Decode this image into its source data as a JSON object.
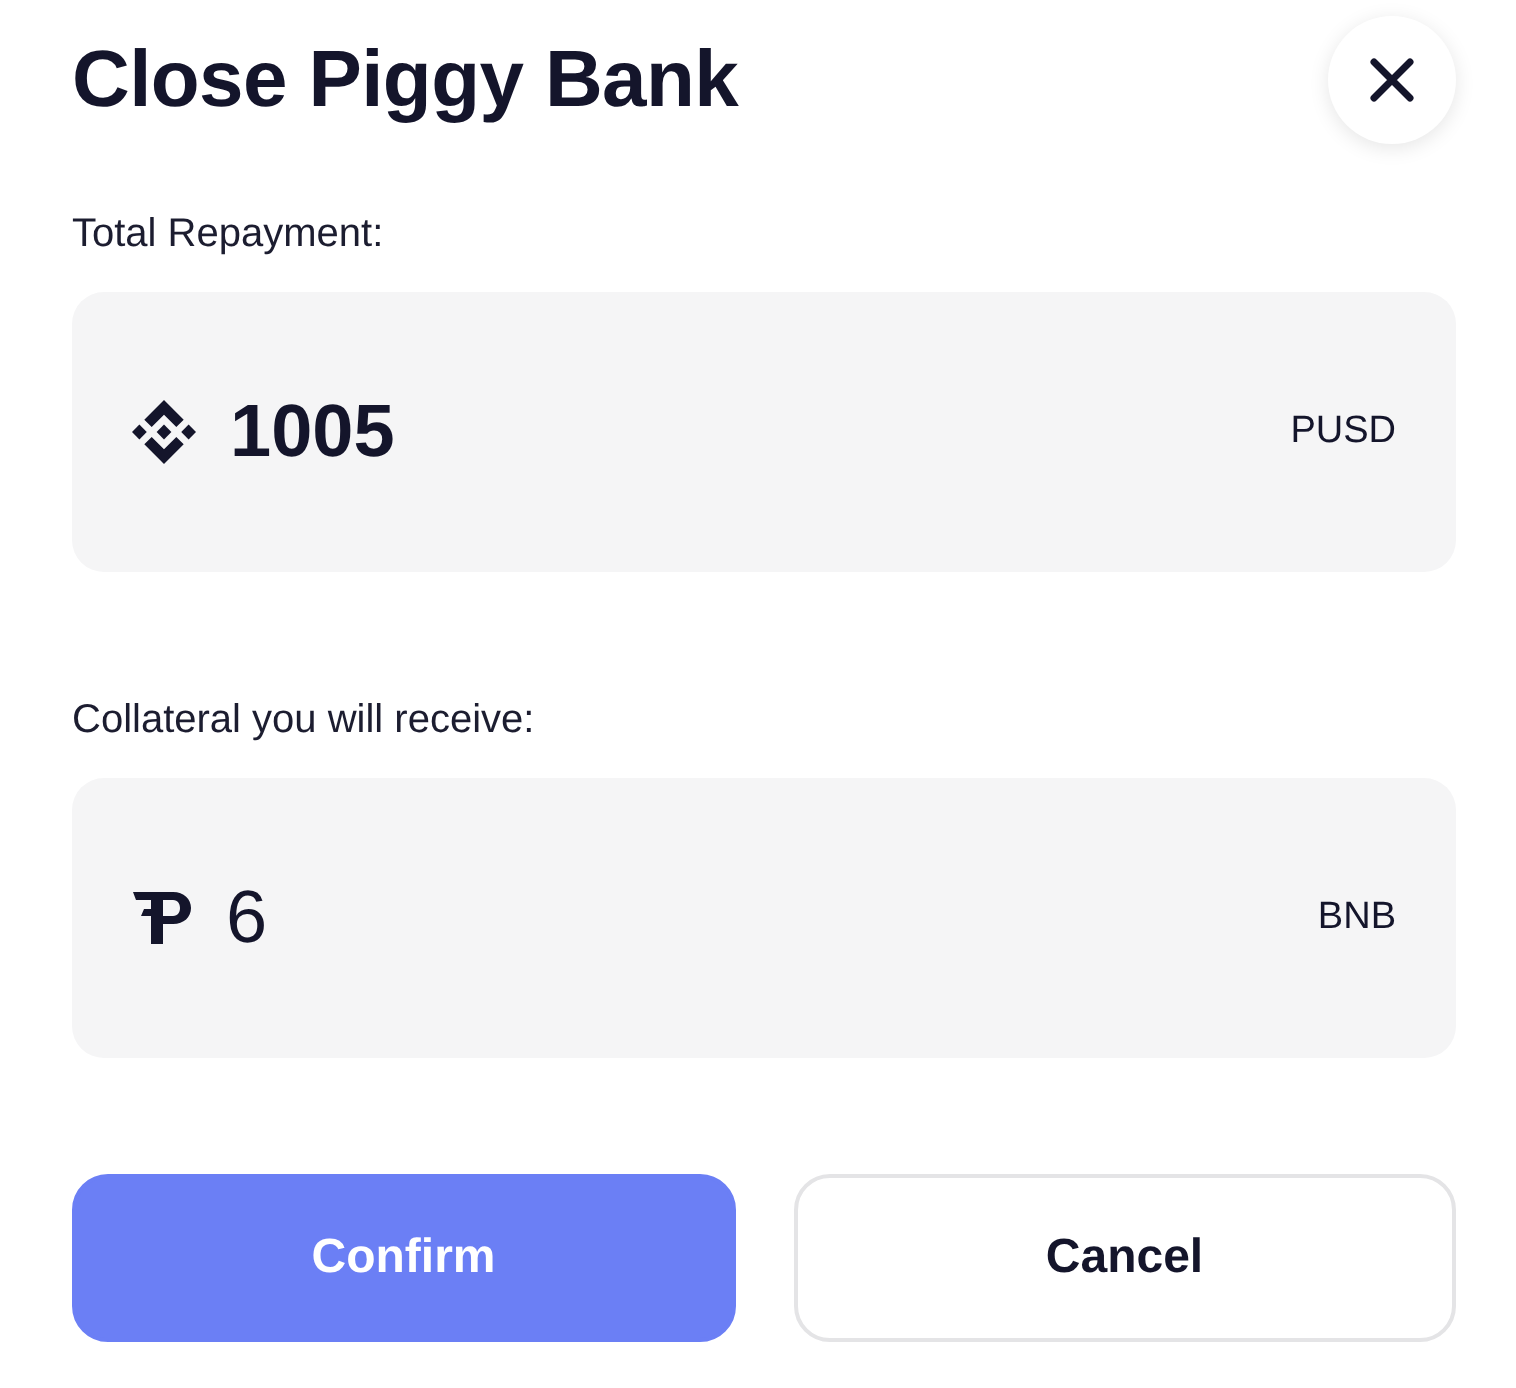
{
  "dialog": {
    "title": "Close Piggy Bank"
  },
  "total_repayment": {
    "label": "Total Repayment:",
    "amount": "1005",
    "unit": "PUSD"
  },
  "collateral": {
    "label": "Collateral you will receive:",
    "amount": "6",
    "unit": "BNB"
  },
  "buttons": [
    {
      "label": "Confirm",
      "kind": "primary"
    },
    {
      "label": "Cancel",
      "kind": "secondary"
    }
  ]
}
